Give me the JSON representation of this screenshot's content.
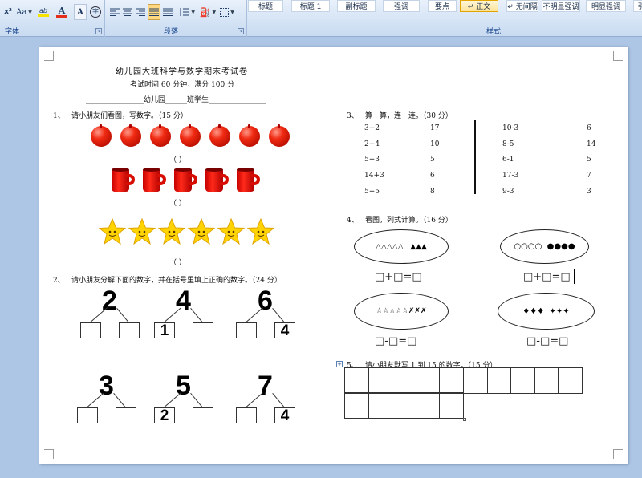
{
  "ribbon": {
    "font_group": {
      "label": "字体",
      "superscript_label": "x²",
      "change_case_label": "Aa",
      "highlight_label": "ab",
      "font_color_label": "A",
      "char_shading_label": "A",
      "enclose_label": "字"
    },
    "paragraph_group": {
      "label": "段落"
    },
    "styles_group": {
      "label": "样式",
      "styles": [
        {
          "label": "标题",
          "active": false
        },
        {
          "label": "标题 1",
          "active": false
        },
        {
          "label": "副标题",
          "active": false
        },
        {
          "label": "强调",
          "active": false
        },
        {
          "label": "要点",
          "active": false
        },
        {
          "label": "↵ 正文",
          "active": true
        },
        {
          "label": "↵ 无间隔",
          "active": false
        },
        {
          "label": "不明显强调",
          "active": false
        },
        {
          "label": "明显强调",
          "active": false
        },
        {
          "label": "引",
          "active": false
        }
      ]
    },
    "colors": {
      "highlight": "#f7e200",
      "font_color": "#e52d1b"
    }
  },
  "document": {
    "title": "幼儿园大班科学与数学期末考试卷",
    "subtitle": "考试时间 60 分钟，满分 100 分",
    "student_line": "________________幼儿园______班学生________________",
    "q1": {
      "number": "1、",
      "text": "请小朋友们看图，写数字。（15 分）",
      "paren": "（        ）",
      "apples_count": 7,
      "cups_count": 5,
      "stars_count": 6
    },
    "q2": {
      "number": "2、",
      "text": "请小朋友分解下面的数字，并在括号里填上正确的数字。（24 分）",
      "items": [
        {
          "total": "2",
          "left": "",
          "right": ""
        },
        {
          "total": "4",
          "left": "1",
          "right": ""
        },
        {
          "total": "6",
          "left": "",
          "right": "4"
        },
        {
          "total": "3",
          "left": "",
          "right": ""
        },
        {
          "total": "5",
          "left": "2",
          "right": ""
        },
        {
          "total": "7",
          "left": "",
          "right": "4"
        }
      ]
    },
    "q3": {
      "number": "3、",
      "text": "算一算，连一连。（30 分）",
      "left_exprs": [
        "3+2",
        "2+4",
        "5+3",
        "14+3",
        "5+5"
      ],
      "left_answers": [
        "17",
        "10",
        "5",
        "6",
        "8"
      ],
      "right_exprs": [
        "10-3",
        "8-5",
        "6-1",
        "17-3",
        "9-3"
      ],
      "right_answers": [
        "6",
        "14",
        "5",
        "7",
        "3"
      ]
    },
    "q4": {
      "number": "4、",
      "text": "看图，列式计算。（16 分）",
      "ellipses": [
        {
          "content": "△△△△△   ▲▲▲",
          "equation": "□+□=□"
        },
        {
          "content": "○○○○  ●●●●",
          "equation": "□+□=□"
        },
        {
          "content": "☆☆☆☆☆✗✗✗",
          "equation": "□-□=□"
        },
        {
          "content": "♦♦♦  ✦✦✦",
          "equation": "□-□=□"
        }
      ]
    },
    "q5": {
      "number": "5、",
      "text": "请小朋友默写 1 到 15 的数字。（15 分）"
    }
  }
}
